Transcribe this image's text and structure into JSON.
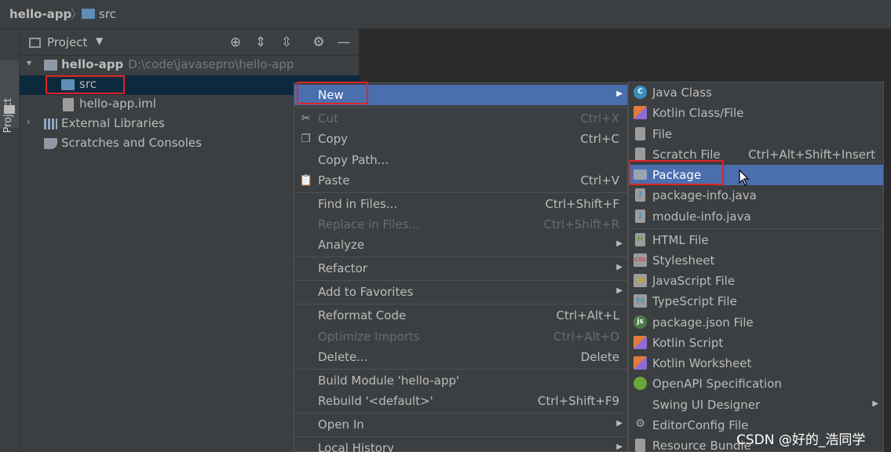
{
  "nav": {
    "project": "hello-app",
    "separator": "〉",
    "folder": "src"
  },
  "tool_strip": {
    "project_tab": "Project"
  },
  "panel": {
    "title": "Project",
    "caret": "▼"
  },
  "tree": {
    "root": {
      "name": "hello-app",
      "path": "D:\\code\\javasepro\\hello-app"
    },
    "src": "src",
    "iml": "hello-app.iml",
    "external": "External Libraries",
    "scratches": "Scratches and Consoles"
  },
  "context_menu": {
    "new": "New",
    "cut": "Cut",
    "cut_sc": "Ctrl+X",
    "copy": "Copy",
    "copy_sc": "Ctrl+C",
    "copy_path": "Copy Path...",
    "paste": "Paste",
    "paste_sc": "Ctrl+V",
    "find": "Find in Files...",
    "find_sc": "Ctrl+Shift+F",
    "replace": "Replace in Files...",
    "replace_sc": "Ctrl+Shift+R",
    "analyze": "Analyze",
    "refactor": "Refactor",
    "favorites": "Add to Favorites",
    "reformat": "Reformat Code",
    "reformat_sc": "Ctrl+Alt+L",
    "optimize": "Optimize Imports",
    "optimize_sc": "Ctrl+Alt+O",
    "delete": "Delete...",
    "delete_sc": "Delete",
    "build": "Build Module 'hello-app'",
    "rebuild": "Rebuild '<default>'",
    "rebuild_sc": "Ctrl+Shift+F9",
    "open_in": "Open In",
    "local_history": "Local History"
  },
  "submenu": {
    "java_class": "Java Class",
    "kotlin_class": "Kotlin Class/File",
    "file": "File",
    "scratch": "Scratch File",
    "scratch_sc": "Ctrl+Alt+Shift+Insert",
    "package": "Package",
    "package_info": "package-info.java",
    "module_info": "module-info.java",
    "html": "HTML File",
    "stylesheet": "Stylesheet",
    "js": "JavaScript File",
    "ts": "TypeScript File",
    "package_json": "package.json File",
    "kotlin_script": "Kotlin Script",
    "kotlin_worksheet": "Kotlin Worksheet",
    "openapi": "OpenAPI Specification",
    "swing": "Swing UI Designer",
    "editorconfig": "EditorConfig File",
    "resource_bundle": "Resource Bundle"
  },
  "watermark": "CSDN @好的_浩同学",
  "colors": {
    "selection": "#4b6eaf",
    "highlight": "#e02424",
    "menu_bg": "#3c3f41"
  }
}
